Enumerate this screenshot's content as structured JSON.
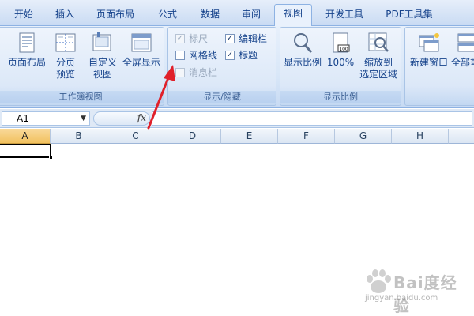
{
  "tabs": [
    {
      "label": "开始",
      "active": false
    },
    {
      "label": "插入",
      "active": false
    },
    {
      "label": "页面布局",
      "active": false
    },
    {
      "label": "公式",
      "active": false
    },
    {
      "label": "数据",
      "active": false
    },
    {
      "label": "审阅",
      "active": false
    },
    {
      "label": "视图",
      "active": true
    },
    {
      "label": "开发工具",
      "active": false
    },
    {
      "label": "PDF工具集",
      "active": false
    }
  ],
  "ribbon": {
    "workbook_views": {
      "label": "工作簿视图",
      "page_layout": {
        "line1": "页面布局"
      },
      "page_break": {
        "line1": "分页",
        "line2": "预览"
      },
      "custom_view": {
        "line1": "自定义",
        "line2": "视图"
      },
      "full_screen": {
        "line1": "全屏显示"
      }
    },
    "show_hide": {
      "label": "显示/隐藏",
      "ruler": {
        "label": "标尺",
        "checked": true,
        "disabled": true
      },
      "gridlines": {
        "label": "网格线",
        "checked": false,
        "disabled": false
      },
      "message_bar": {
        "label": "消息栏",
        "checked": false,
        "disabled": true
      },
      "formula_bar": {
        "label": "编辑栏",
        "checked": true,
        "disabled": false
      },
      "headings": {
        "label": "标题",
        "checked": true,
        "disabled": false
      }
    },
    "zoom": {
      "label": "显示比例",
      "zoom_btn": {
        "line1": "显示比例"
      },
      "zoom_100": {
        "line1": "100%"
      },
      "zoom_selection": {
        "line1": "缩放到",
        "line2": "选定区域"
      }
    },
    "window": {
      "new_window": {
        "line1": "新建窗口"
      },
      "arrange_all": {
        "line1": "全部重"
      }
    }
  },
  "formula_bar": {
    "name_box": "A1",
    "fx": "fx",
    "value": ""
  },
  "columns": [
    "A",
    "B",
    "C",
    "D",
    "E",
    "F",
    "G",
    "H"
  ],
  "watermark": {
    "text": "Bai度经验",
    "sub": "jingyan.baidu.com"
  },
  "colors": {
    "accent": "#15428b",
    "ribbon_bg": "#dbe7f8",
    "arrow": "#e0202a",
    "selected_header": "#f1c15f"
  }
}
